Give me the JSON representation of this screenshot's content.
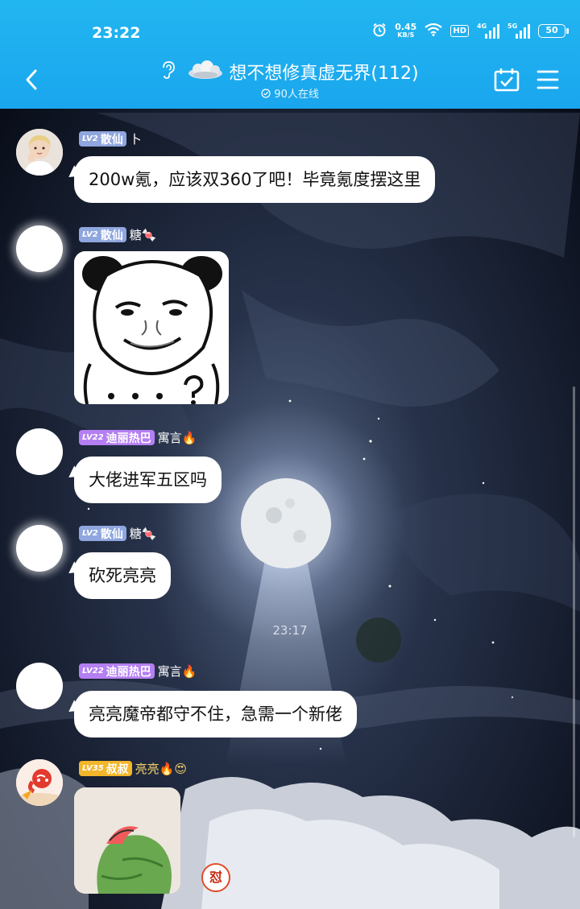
{
  "status_bar": {
    "time": "23:22",
    "speed": "0.45",
    "speed_unit": "KB/S",
    "hd": "HD",
    "net1": "4G",
    "net2": "5G",
    "battery": "50"
  },
  "header": {
    "title": "想不想修真虚无界(112)",
    "online": "90人在线"
  },
  "messages": [
    {
      "level": "LV2",
      "rank": "散仙",
      "name": "卜",
      "text": "200w氪，应该双360了吧！毕竟氪度摆这里"
    },
    {
      "level": "LV2",
      "rank": "散仙",
      "name": "糖🍬"
    },
    {
      "level": "LV22",
      "rank": "迪丽热巴",
      "name": "寓言🔥",
      "text": "大佬进军五区吗"
    },
    {
      "level": "LV2",
      "rank": "散仙",
      "name": "糖🍬",
      "text": "砍死亮亮"
    },
    {
      "level": "LV22",
      "rank": "迪丽热巴",
      "name": "寓言🔥",
      "text": "亮亮魔帝都守不住，急需一个新佬"
    },
    {
      "level": "LV35",
      "rank": "叔叔",
      "name": "亮亮🔥😍"
    }
  ],
  "timestamp": "23:17",
  "reaction": "怼",
  "colors": {
    "header": "#1aa6ee",
    "lv_blue": "#8fa6de",
    "lv_purple": "#b47ff2",
    "lv_orange": "#f3b62a"
  }
}
